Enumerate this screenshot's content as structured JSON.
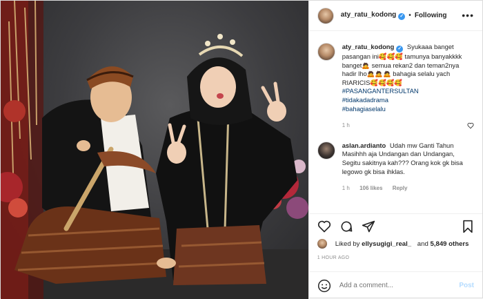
{
  "header": {
    "username": "aty_ratu_kodong",
    "verified_mark": "✓",
    "separator": "•",
    "follow_label": "Following",
    "more_label": "•••"
  },
  "caption": {
    "username": "aty_ratu_kodong",
    "line1": "Syukaaa banget pasangan ini🥰🥰🥰 tamunya banyakkkk banget🙇 semua rekan2 dan teman2nya hadir lho🙇🙇🙇 bahagia selalu yach RIARICIS🥰🥰🥰🥰",
    "tags": [
      "#PASANGANTERSULTAN",
      "#tidakadadrama",
      "#bahagiaselalu"
    ],
    "age": "1 h"
  },
  "comment": {
    "username": "aslan.ardianto",
    "text": "Udah mw Ganti Tahun Masihhh aja Undangan dan Undangan, Segitu sakitnya kah??? Orang kok gk bisa legowo gk bisa ihklas.",
    "age": "1 h",
    "likes": "106 likes",
    "reply_label": "Reply"
  },
  "actions": {
    "like_icon": "heart-icon",
    "comment_icon": "comment-icon",
    "share_icon": "share-icon",
    "save_icon": "bookmark-icon"
  },
  "likes": {
    "prefix": "Liked by",
    "first_user": "ellysugigi_real_",
    "conjunction": "and",
    "others": "5,849 others"
  },
  "timestamp": "1 HOUR AGO",
  "add_comment": {
    "placeholder": "Add a comment...",
    "post_label": "Post"
  },
  "colors": {
    "link": "#00376b",
    "muted": "#8e8e8e",
    "verified": "#3897f0",
    "post_disabled": "#b3dbff"
  }
}
